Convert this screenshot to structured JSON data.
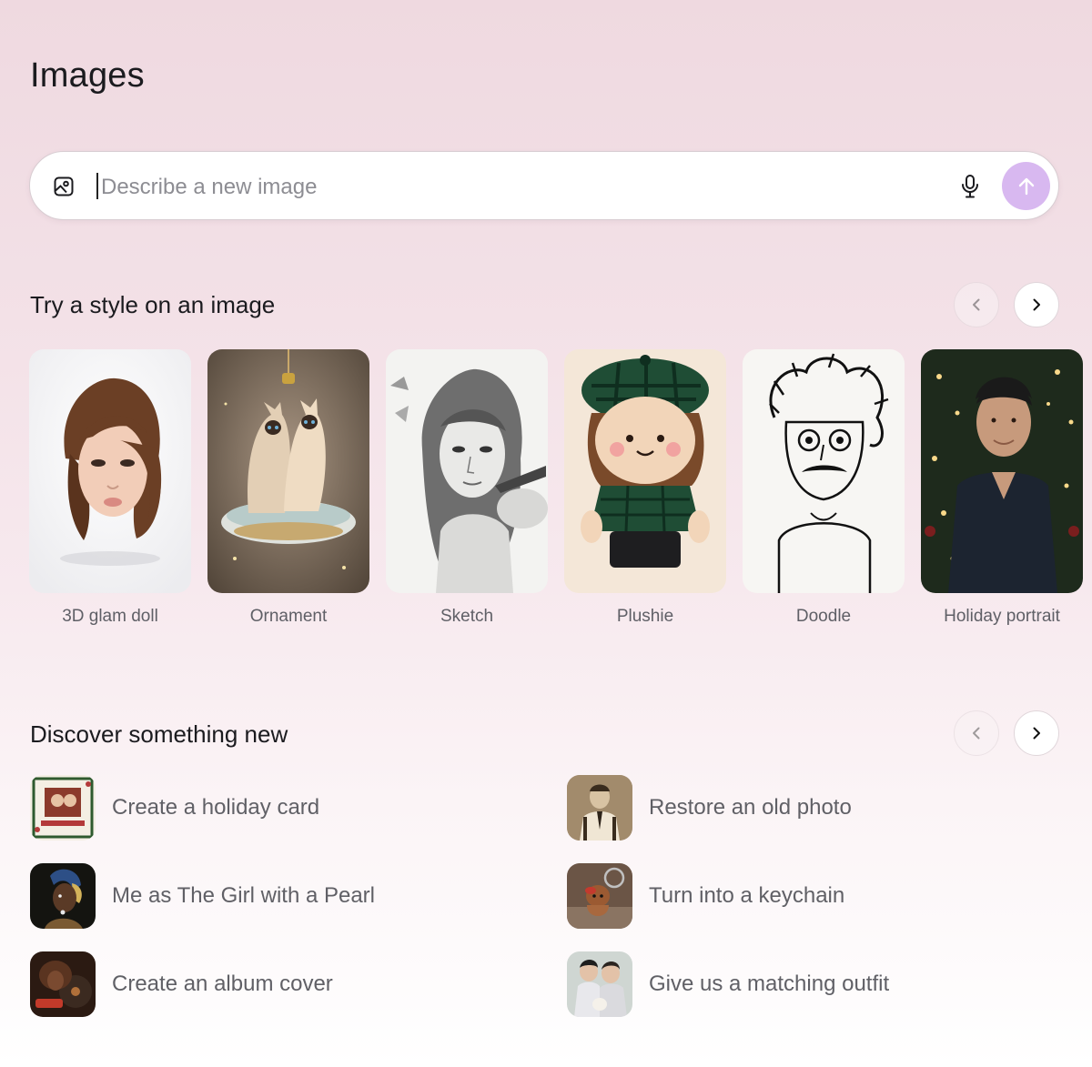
{
  "page": {
    "title": "Images"
  },
  "prompt": {
    "placeholder": "Describe a new image",
    "value": "",
    "image_icon": "image-add-icon",
    "mic_icon": "microphone-icon",
    "send_icon": "arrow-up-icon",
    "send_color": "#d8b8f0"
  },
  "styles_section": {
    "title": "Try a style on an image",
    "prev_icon": "chevron-left-icon",
    "next_icon": "chevron-right-icon",
    "items": [
      {
        "label": "3D glam doll"
      },
      {
        "label": "Ornament"
      },
      {
        "label": "Sketch"
      },
      {
        "label": "Plushie"
      },
      {
        "label": "Doodle"
      },
      {
        "label": "Holiday portrait"
      }
    ]
  },
  "discover_section": {
    "title": "Discover something new",
    "prev_icon": "chevron-left-icon",
    "next_icon": "chevron-right-icon",
    "items": [
      {
        "label": "Create a holiday card"
      },
      {
        "label": "Restore an old photo"
      },
      {
        "label": "Me as The Girl with a Pearl"
      },
      {
        "label": "Turn into a keychain"
      },
      {
        "label": "Create an album cover"
      },
      {
        "label": "Give us a matching outfit"
      }
    ]
  }
}
